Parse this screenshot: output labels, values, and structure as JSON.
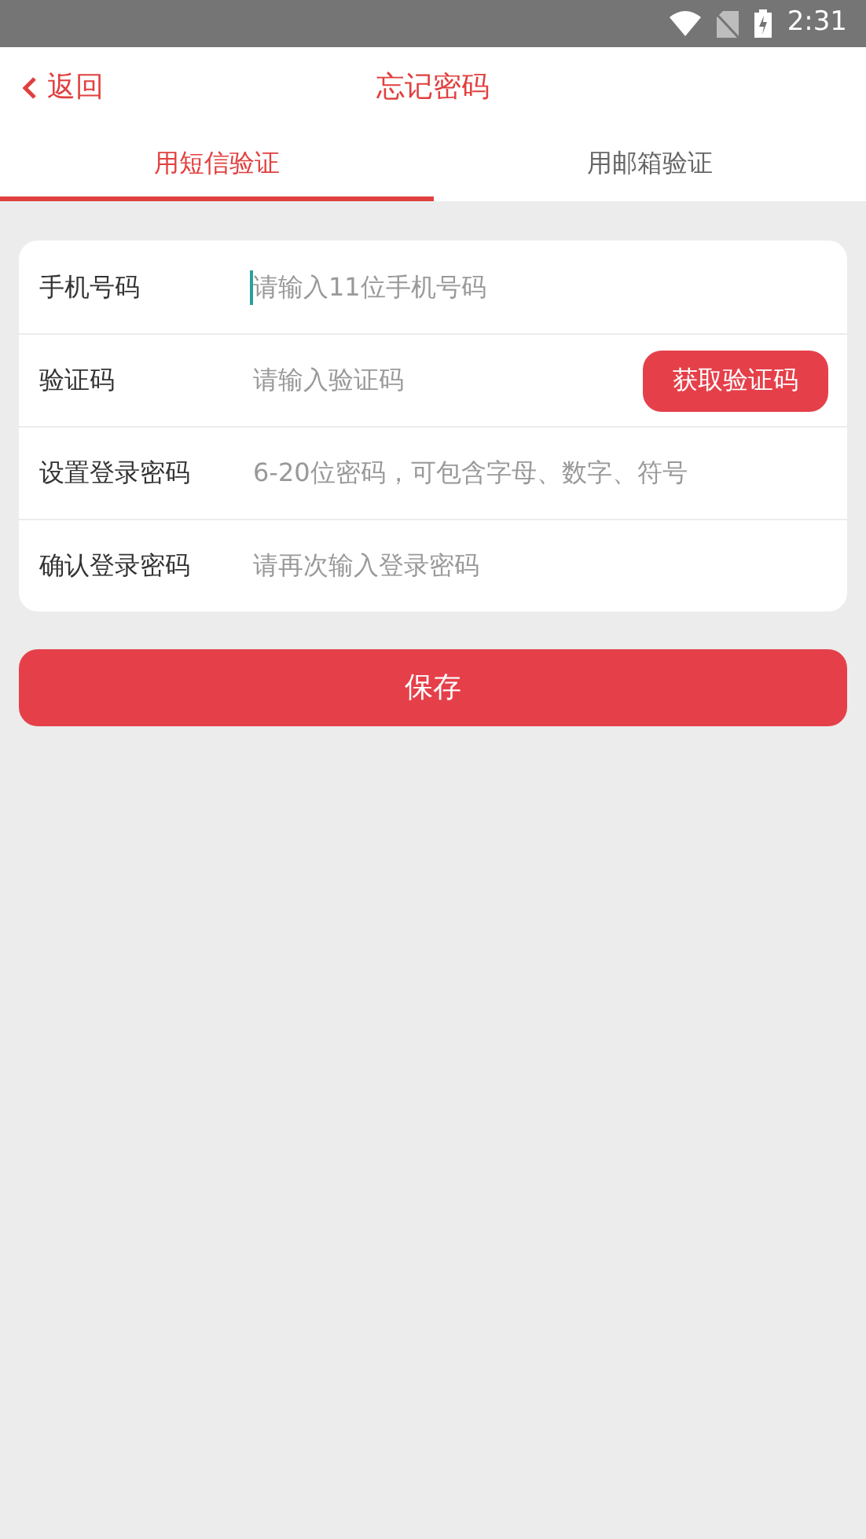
{
  "status_bar": {
    "time": "2:31"
  },
  "header": {
    "back": "返回",
    "title": "忘记密码"
  },
  "tabs": [
    {
      "label": "用短信验证",
      "selected": true
    },
    {
      "label": "用邮箱验证",
      "selected": false
    }
  ],
  "fields": [
    {
      "kind": "text",
      "label": "手机号码",
      "placeholder": "请输入11位手机号码",
      "focused": true
    },
    {
      "kind": "code",
      "label": "验证码",
      "placeholder": "请输入验证码",
      "focused": false,
      "button": "获取验证码"
    },
    {
      "kind": "text",
      "label": "设置登录密码",
      "placeholder": "6-20位密码，可包含字母、数字、符号",
      "focused": false
    },
    {
      "kind": "text",
      "label": "确认登录密码",
      "placeholder": "请再次输入登录密码",
      "focused": false
    }
  ],
  "save_button": "保存"
}
